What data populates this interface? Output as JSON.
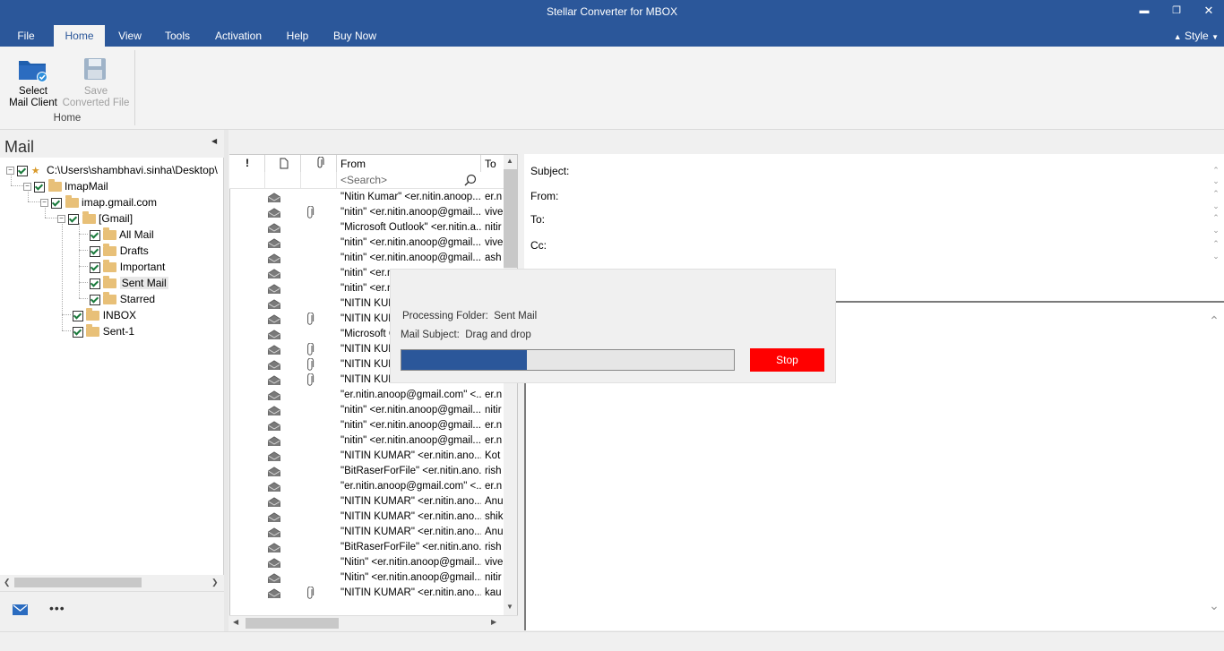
{
  "window": {
    "title": "Stellar Converter for MBOX",
    "controls": [
      "minimize-icon",
      "restore-icon",
      "close-icon"
    ]
  },
  "menu": {
    "tabs": [
      "File",
      "Home",
      "View",
      "Tools",
      "Activation",
      "Help",
      "Buy Now"
    ],
    "active_tab": "Home",
    "style_label": "Style"
  },
  "ribbon": {
    "select_mail_client": {
      "line1": "Select",
      "line2": "Mail Client",
      "icon": "folder-check-icon"
    },
    "save_converted_file": {
      "line1": "Save",
      "line2": "Converted File",
      "icon": "save-disk-icon",
      "disabled": true
    },
    "group_label": "Home"
  },
  "sidebar": {
    "title": "Mail",
    "tree": [
      {
        "label": "C:\\Users\\shambhavi.sinha\\Desktop\\",
        "level": 0
      },
      {
        "label": "ImapMail",
        "level": 1
      },
      {
        "label": "imap.gmail.com",
        "level": 2
      },
      {
        "label": "[Gmail]",
        "level": 3
      },
      {
        "label": "All Mail",
        "level": 4
      },
      {
        "label": "Drafts",
        "level": 4
      },
      {
        "label": "Important",
        "level": 4
      },
      {
        "label": "Sent Mail",
        "level": 4,
        "selected": true
      },
      {
        "label": "Starred",
        "level": 4
      },
      {
        "label": "INBOX",
        "level": 3
      },
      {
        "label": "Sent-1",
        "level": 3
      }
    ],
    "bottom_nav": {
      "mail_icon": "envelope-icon",
      "more": "•••"
    }
  },
  "message_list": {
    "columns": {
      "importance": "!",
      "type": "document-icon",
      "attachment": "paperclip-icon",
      "from": "From",
      "to": "To"
    },
    "search_placeholder": "<Search>",
    "rows": [
      {
        "from": "\"Nitin Kumar\" <er.nitin.anoop...",
        "to": "er.n",
        "attach": false
      },
      {
        "from": "\"nitin\" <er.nitin.anoop@gmail....",
        "to": "vive",
        "attach": true
      },
      {
        "from": "\"Microsoft Outlook\" <er.nitin.a...",
        "to": "nitir",
        "attach": false
      },
      {
        "from": "\"nitin\" <er.nitin.anoop@gmail....",
        "to": "vive",
        "attach": false
      },
      {
        "from": "\"nitin\" <er.nitin.anoop@gmail....",
        "to": "ash",
        "attach": false
      },
      {
        "from": "\"nitin\" <er.n",
        "to": "",
        "attach": false
      },
      {
        "from": "\"nitin\" <er.n",
        "to": "",
        "attach": false
      },
      {
        "from": "\"NITIN KUM",
        "to": "",
        "attach": false
      },
      {
        "from": "\"NITIN KUM",
        "to": "",
        "attach": true
      },
      {
        "from": "\"Microsoft C",
        "to": "",
        "attach": false
      },
      {
        "from": "\"NITIN KUM",
        "to": "",
        "attach": true
      },
      {
        "from": "\"NITIN KUM",
        "to": "",
        "attach": true
      },
      {
        "from": "\"NITIN KUMAR\" <er.nitin.ano...",
        "to": "",
        "attach": true
      },
      {
        "from": "\"er.nitin.anoop@gmail.com\" <...",
        "to": "er.n",
        "attach": false
      },
      {
        "from": "\"nitin\" <er.nitin.anoop@gmail....",
        "to": "nitir",
        "attach": false
      },
      {
        "from": "\"nitin\" <er.nitin.anoop@gmail....",
        "to": "er.n",
        "attach": false
      },
      {
        "from": "\"nitin\" <er.nitin.anoop@gmail....",
        "to": "er.n",
        "attach": false
      },
      {
        "from": "\"NITIN KUMAR\" <er.nitin.ano...",
        "to": "Kot",
        "attach": false
      },
      {
        "from": "\"BitRaserForFile\" <er.nitin.ano...",
        "to": "rish",
        "attach": false
      },
      {
        "from": "\"er.nitin.anoop@gmail.com\" <...",
        "to": "er.n",
        "attach": false
      },
      {
        "from": "\"NITIN KUMAR\" <er.nitin.ano...",
        "to": "Anu",
        "attach": false
      },
      {
        "from": "\"NITIN KUMAR\" <er.nitin.ano...",
        "to": "shik",
        "attach": false
      },
      {
        "from": "\"NITIN KUMAR\" <er.nitin.ano...",
        "to": "Anu",
        "attach": false
      },
      {
        "from": "\"BitRaserForFile\" <er.nitin.ano...",
        "to": "rish",
        "attach": false
      },
      {
        "from": "\"Nitin\" <er.nitin.anoop@gmail....",
        "to": "vive",
        "attach": false
      },
      {
        "from": "\"Nitin\" <er.nitin.anoop@gmail....",
        "to": "nitir",
        "attach": false
      },
      {
        "from": "\"NITIN KUMAR\" <er.nitin.ano...",
        "to": "kau",
        "attach": true
      }
    ]
  },
  "preview": {
    "subject_label": "Subject:",
    "from_label": "From:",
    "to_label": "To:",
    "cc_label": "Cc:"
  },
  "progress_dialog": {
    "folder_label": "Processing Folder:",
    "folder_value": "Sent Mail",
    "subject_label": "Mail Subject:",
    "subject_value": "Drag and drop",
    "progress_fraction": 0.378,
    "stop_label": "Stop"
  },
  "colors": {
    "accent": "#2b579a",
    "stop": "#ff0000",
    "folder": "#e8c078"
  }
}
